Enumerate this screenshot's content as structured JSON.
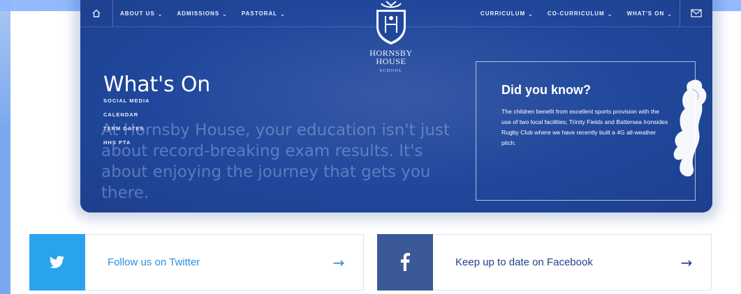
{
  "colors": {
    "hero_bg": "#20479c",
    "twitter": "#2aa3ef",
    "facebook": "#3b5998",
    "frame": "#7aa7ee"
  },
  "nav": {
    "left_items": [
      {
        "label": "ABOUT US"
      },
      {
        "label": "ADMISSIONS"
      },
      {
        "label": "PASTORAL"
      }
    ],
    "right_items": [
      {
        "label": "CURRICULUM"
      },
      {
        "label": "CO-CURRICULUM"
      },
      {
        "label": "WHAT'S ON"
      }
    ],
    "left_icon": "home-icon",
    "right_icon": "mail-icon"
  },
  "school": {
    "name_line1": "HORNSBY",
    "name_line2": "HOUSE",
    "name_line3": "SCHOOL",
    "crest_letters": "H H"
  },
  "page": {
    "title": "What's On",
    "side_links": [
      "SOCIAL MEDIA",
      "CALENDAR",
      "TERM DATES",
      "HHS PTA"
    ],
    "intro": "At Hornsby House, your education isn't just about record-breaking exam results. It's about enjoying the journey that gets you there."
  },
  "did_you_know": {
    "title": "Did you know?",
    "text": "The children benefit from excellent sports provision with the use of two local facilities; Trinity Fields and Battersea Ironsides Rugby Club where we have recently built a 4G all-weather pitch."
  },
  "social": {
    "twitter_label": "Follow us on Twitter",
    "facebook_label": "Keep up to date on Facebook",
    "arrow": "→"
  }
}
